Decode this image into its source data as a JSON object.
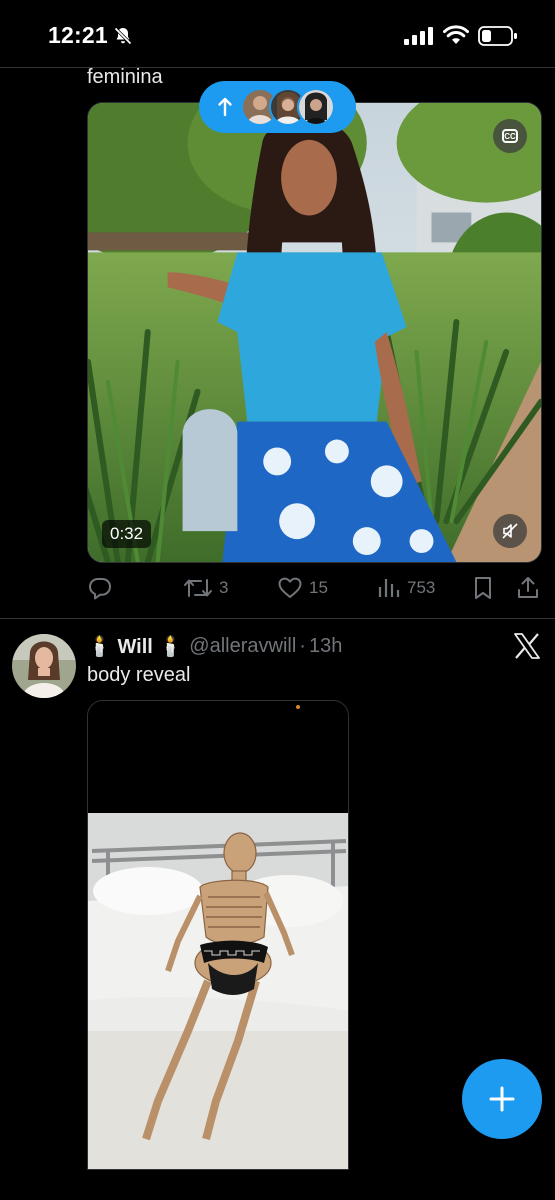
{
  "status_bar": {
    "time": "12:21",
    "icons": [
      "bell-slash-icon",
      "cellular-signal-icon",
      "wifi-icon",
      "battery-icon"
    ]
  },
  "tweet1": {
    "text": "feminina",
    "video": {
      "duration": "0:32",
      "captions_label": "CC",
      "icons": [
        "captions-icon",
        "muted-speaker-icon"
      ]
    },
    "actions": {
      "reply_count": "",
      "retweet_count": "3",
      "like_count": "15",
      "view_count": "753"
    }
  },
  "new_posts_pill": {
    "icon": "arrow-up-icon",
    "avatar_count": 3
  },
  "tweet2": {
    "display_name": "🕯️ Will 🕯️",
    "handle": "@alleravwill",
    "separator": "·",
    "time_ago": "13h",
    "text": "body reveal",
    "source_icon": "x-logo-icon"
  },
  "fab": {
    "icon": "plus-icon"
  },
  "colors": {
    "accent": "#1d9bf0",
    "background": "#000000",
    "text_primary": "#e7e9ea",
    "text_secondary": "#71767b",
    "divider": "#2f3336"
  }
}
